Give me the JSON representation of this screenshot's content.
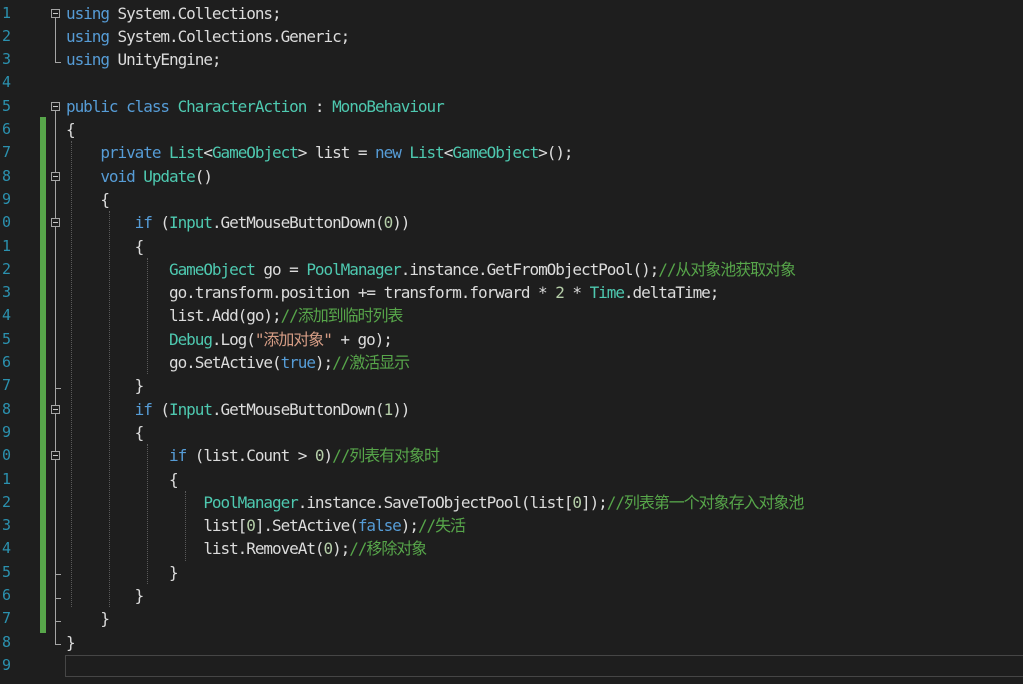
{
  "editor": {
    "language": "csharp",
    "theme": {
      "background": "#1e1e1e",
      "line_number": "#2b91af",
      "keyword": "#569cd6",
      "type": "#4ec9b0",
      "comment": "#57a64a",
      "string": "#d69d85",
      "number": "#b5cea8",
      "text": "#dcdcdc",
      "change_bar": "#57a64a"
    },
    "lines": [
      {
        "num": "1",
        "tokens": [
          {
            "t": "kw",
            "v": "using"
          },
          {
            "t": "tx",
            "v": " System.Collections;"
          }
        ]
      },
      {
        "num": "2",
        "tokens": [
          {
            "t": "kw",
            "v": "using"
          },
          {
            "t": "tx",
            "v": " System.Collections.Generic;"
          }
        ]
      },
      {
        "num": "3",
        "tokens": [
          {
            "t": "kw",
            "v": "using"
          },
          {
            "t": "tx",
            "v": " UnityEngine;"
          }
        ]
      },
      {
        "num": "4",
        "tokens": []
      },
      {
        "num": "5",
        "tokens": [
          {
            "t": "kw",
            "v": "public class "
          },
          {
            "t": "ty",
            "v": "CharacterAction"
          },
          {
            "t": "tx",
            "v": " : "
          },
          {
            "t": "ty",
            "v": "MonoBehaviour"
          }
        ]
      },
      {
        "num": "6",
        "tokens": [
          {
            "t": "tx",
            "v": "{"
          }
        ]
      },
      {
        "num": "7",
        "tokens": [
          {
            "t": "tx",
            "v": "    "
          },
          {
            "t": "kw",
            "v": "private "
          },
          {
            "t": "ty",
            "v": "List"
          },
          {
            "t": "tx",
            "v": "<"
          },
          {
            "t": "ty",
            "v": "GameObject"
          },
          {
            "t": "tx",
            "v": "> list = "
          },
          {
            "t": "kw",
            "v": "new "
          },
          {
            "t": "ty",
            "v": "List"
          },
          {
            "t": "tx",
            "v": "<"
          },
          {
            "t": "ty",
            "v": "GameObject"
          },
          {
            "t": "tx",
            "v": ">();"
          }
        ]
      },
      {
        "num": "8",
        "tokens": [
          {
            "t": "tx",
            "v": "    "
          },
          {
            "t": "kw",
            "v": "void "
          },
          {
            "t": "ty",
            "v": "Update"
          },
          {
            "t": "tx",
            "v": "()"
          }
        ]
      },
      {
        "num": "9",
        "tokens": [
          {
            "t": "tx",
            "v": "    {"
          }
        ]
      },
      {
        "num": "0",
        "tokens": [
          {
            "t": "tx",
            "v": "        "
          },
          {
            "t": "kw",
            "v": "if"
          },
          {
            "t": "tx",
            "v": " ("
          },
          {
            "t": "ty",
            "v": "Input"
          },
          {
            "t": "tx",
            "v": ".GetMouseButtonDown("
          },
          {
            "t": "nu",
            "v": "0"
          },
          {
            "t": "tx",
            "v": "))"
          }
        ]
      },
      {
        "num": "1",
        "tokens": [
          {
            "t": "tx",
            "v": "        {"
          }
        ]
      },
      {
        "num": "2",
        "tokens": [
          {
            "t": "tx",
            "v": "            "
          },
          {
            "t": "ty",
            "v": "GameObject"
          },
          {
            "t": "tx",
            "v": " go = "
          },
          {
            "t": "ty",
            "v": "PoolManager"
          },
          {
            "t": "tx",
            "v": ".instance.GetFromObjectPool();"
          },
          {
            "t": "cm",
            "v": "//从对象池获取对象"
          }
        ]
      },
      {
        "num": "3",
        "tokens": [
          {
            "t": "tx",
            "v": "            go.transform.position += transform.forward * "
          },
          {
            "t": "nu",
            "v": "2"
          },
          {
            "t": "tx",
            "v": " * "
          },
          {
            "t": "ty",
            "v": "Time"
          },
          {
            "t": "tx",
            "v": ".deltaTime;"
          }
        ]
      },
      {
        "num": "4",
        "tokens": [
          {
            "t": "tx",
            "v": "            list.Add(go);"
          },
          {
            "t": "cm",
            "v": "//添加到临时列表"
          }
        ]
      },
      {
        "num": "5",
        "tokens": [
          {
            "t": "tx",
            "v": "            "
          },
          {
            "t": "ty",
            "v": "Debug"
          },
          {
            "t": "tx",
            "v": ".Log("
          },
          {
            "t": "st",
            "v": "\"添加对象\""
          },
          {
            "t": "tx",
            "v": " + go);"
          }
        ]
      },
      {
        "num": "6",
        "tokens": [
          {
            "t": "tx",
            "v": "            go.SetActive("
          },
          {
            "t": "kw",
            "v": "true"
          },
          {
            "t": "tx",
            "v": ");"
          },
          {
            "t": "cm",
            "v": "//激活显示"
          }
        ]
      },
      {
        "num": "7",
        "tokens": [
          {
            "t": "tx",
            "v": "        }"
          }
        ]
      },
      {
        "num": "8",
        "tokens": [
          {
            "t": "tx",
            "v": "        "
          },
          {
            "t": "kw",
            "v": "if"
          },
          {
            "t": "tx",
            "v": " ("
          },
          {
            "t": "ty",
            "v": "Input"
          },
          {
            "t": "tx",
            "v": ".GetMouseButtonDown("
          },
          {
            "t": "nu",
            "v": "1"
          },
          {
            "t": "tx",
            "v": "))"
          }
        ]
      },
      {
        "num": "9",
        "tokens": [
          {
            "t": "tx",
            "v": "        {"
          }
        ]
      },
      {
        "num": "0",
        "tokens": [
          {
            "t": "tx",
            "v": "            "
          },
          {
            "t": "kw",
            "v": "if"
          },
          {
            "t": "tx",
            "v": " (list.Count > "
          },
          {
            "t": "nu",
            "v": "0"
          },
          {
            "t": "tx",
            "v": ")"
          },
          {
            "t": "cm",
            "v": "//列表有对象时"
          }
        ]
      },
      {
        "num": "1",
        "tokens": [
          {
            "t": "tx",
            "v": "            {"
          }
        ]
      },
      {
        "num": "2",
        "tokens": [
          {
            "t": "tx",
            "v": "                "
          },
          {
            "t": "ty",
            "v": "PoolManager"
          },
          {
            "t": "tx",
            "v": ".instance.SaveToObjectPool(list["
          },
          {
            "t": "nu",
            "v": "0"
          },
          {
            "t": "tx",
            "v": "]);"
          },
          {
            "t": "cm",
            "v": "//列表第一个对象存入对象池"
          }
        ]
      },
      {
        "num": "3",
        "tokens": [
          {
            "t": "tx",
            "v": "                list["
          },
          {
            "t": "nu",
            "v": "0"
          },
          {
            "t": "tx",
            "v": "].SetActive("
          },
          {
            "t": "kw",
            "v": "false"
          },
          {
            "t": "tx",
            "v": ");"
          },
          {
            "t": "cm",
            "v": "//失活"
          }
        ]
      },
      {
        "num": "4",
        "tokens": [
          {
            "t": "tx",
            "v": "                list.RemoveAt("
          },
          {
            "t": "nu",
            "v": "0"
          },
          {
            "t": "tx",
            "v": ");"
          },
          {
            "t": "cm",
            "v": "//移除对象"
          }
        ]
      },
      {
        "num": "5",
        "tokens": [
          {
            "t": "tx",
            "v": "            }"
          }
        ]
      },
      {
        "num": "6",
        "tokens": [
          {
            "t": "tx",
            "v": "        }"
          }
        ]
      },
      {
        "num": "7",
        "tokens": [
          {
            "t": "tx",
            "v": "    }"
          }
        ]
      },
      {
        "num": "8",
        "tokens": [
          {
            "t": "tx",
            "v": "}"
          }
        ]
      },
      {
        "num": "9",
        "tokens": []
      }
    ]
  }
}
